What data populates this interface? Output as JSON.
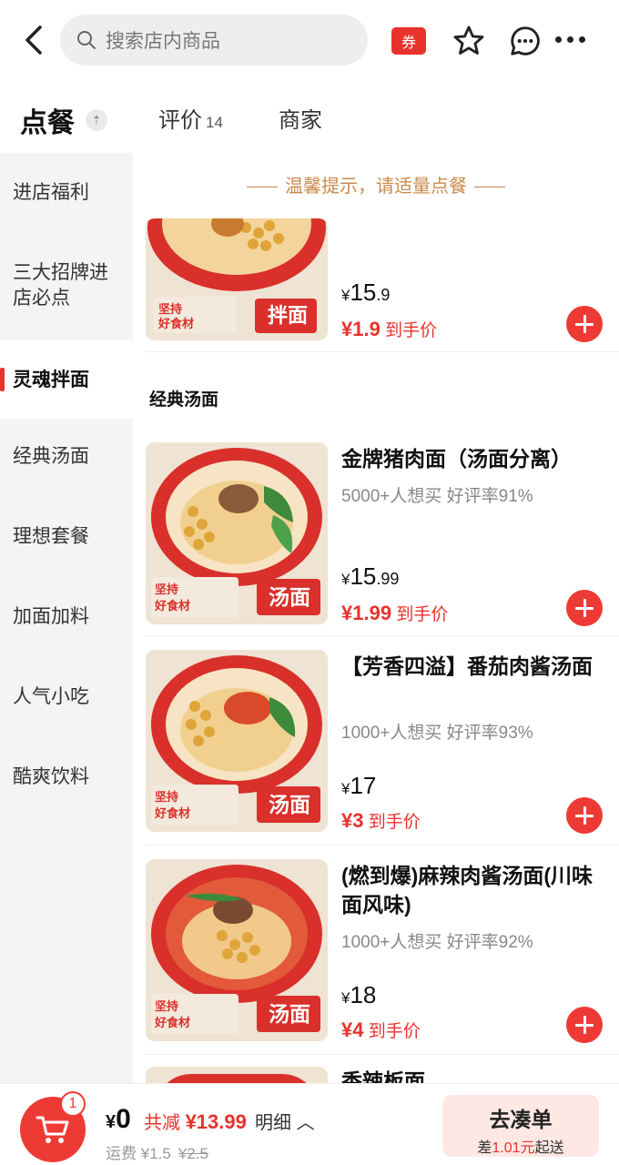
{
  "header": {
    "search_placeholder": "搜索店内商品",
    "coupon_label": "券"
  },
  "tabs": {
    "order": "点餐",
    "review": "评价",
    "review_count": "14",
    "merchant": "商家"
  },
  "sidebar": {
    "items": [
      "进店福利",
      "三大招牌进店必点",
      "灵魂拌面",
      "经典汤面",
      "理想套餐",
      "加面加料",
      "人气小吃",
      "酷爽饮料"
    ],
    "item2_line1": "三大招牌进",
    "item2_line2": "店必点",
    "active_index": 2
  },
  "main": {
    "tip": "温馨提示，请适量点餐",
    "section_title": "经典汤面",
    "partial_item": {
      "price_int": "15",
      "price_dec": ".9",
      "hand_price": "¥1.9",
      "hand_label": "到手价",
      "badge": "拌面"
    },
    "items": [
      {
        "name": "金牌猪肉面（汤面分离）",
        "meta": "5000+人想买 好评率91%",
        "price_int": "15",
        "price_dec": ".99",
        "hand_price": "¥1.99",
        "hand_label": "到手价",
        "badge": "汤面"
      },
      {
        "name": "【芳香四溢】番茄肉酱汤面",
        "meta": "1000+人想买 好评率93%",
        "price_int": "17",
        "price_dec": "",
        "hand_price": "¥3",
        "hand_label": "到手价",
        "badge": "汤面"
      },
      {
        "name": "(燃到爆)麻辣肉酱汤面(川味面风味)",
        "meta": "1000+人想买 好评率92%",
        "price_int": "18",
        "price_dec": "",
        "hand_price": "¥4",
        "hand_label": "到手价",
        "badge": "汤面"
      },
      {
        "name": "香辣板面",
        "meta": "",
        "price_int": "",
        "price_dec": "",
        "hand_price": "",
        "hand_label": "",
        "badge": ""
      }
    ]
  },
  "footer": {
    "cart_count": "1",
    "total": "0",
    "currency": "¥",
    "discount_label": "共减",
    "discount_amount": "¥13.99",
    "detail_label": "明细",
    "shipping_label": "运费",
    "shipping_fee": "¥1.5",
    "shipping_original": "¥2.5",
    "checkout_label": "去凑单",
    "checkout_sub_prefix": "差",
    "checkout_sub_amount": "1.01元",
    "checkout_sub_suffix": "起送"
  },
  "colors": {
    "accent": "#e8322c",
    "tip": "#c98a4a",
    "sidebar_bg": "#f4f4f4"
  }
}
